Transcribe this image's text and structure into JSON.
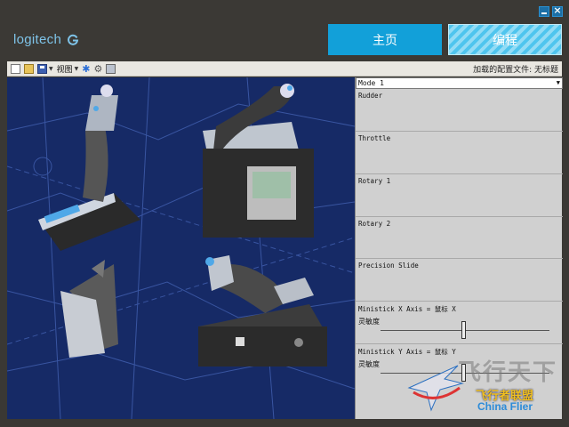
{
  "app": {
    "logo_text": "logitech"
  },
  "window_controls": {
    "minimize_icon": "minimize-icon",
    "close_icon": "close-icon",
    "close_glyph": "×"
  },
  "nav": {
    "home_label": "主页",
    "program_label": "编程"
  },
  "toolbar": {
    "view_label": "视图",
    "status_text": "加载的配置文件: 无标题"
  },
  "panel": {
    "mode_value": "Mode 1",
    "rows": [
      {
        "label": "Rudder"
      },
      {
        "label": "Throttle"
      },
      {
        "label": "Rotary 1"
      },
      {
        "label": "Rotary 2"
      },
      {
        "label": "Precision Slide"
      },
      {
        "label": "Ministick X Axis = 鼠标 X",
        "sensitivity_label": "灵敏度"
      },
      {
        "label": "Ministick Y Axis = 鼠标 Y",
        "sensitivity_label": "灵敏度"
      }
    ]
  },
  "watermark": {
    "big": "飞行天下",
    "cn": "飞行者联盟",
    "en": "China Flier"
  },
  "colors": {
    "home_button": "#12a0d9",
    "program_button": "#4fc5ee",
    "canvas_bg": "#162a66",
    "logo": "#7ec3e8"
  }
}
